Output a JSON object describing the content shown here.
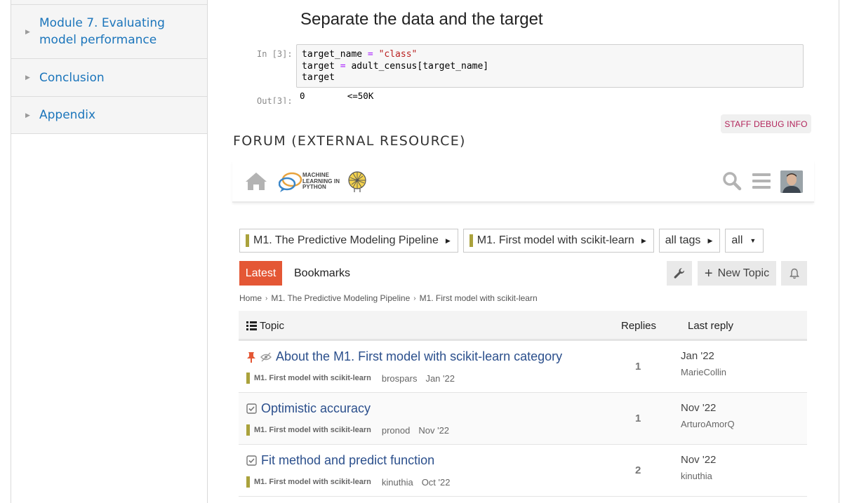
{
  "sidebar": {
    "items": [
      {
        "label": "Module 7. Evaluating model performance"
      },
      {
        "label": "Conclusion"
      },
      {
        "label": "Appendix"
      }
    ]
  },
  "notebook": {
    "heading": "Separate the data and the target",
    "in_prompt": "In [3]:",
    "out_prompt": "Out[3]:",
    "code": {
      "line1_var": "target_name",
      "line1_op": " = ",
      "line1_str": "\"class\"",
      "line2_var": "target",
      "line2_op": " = ",
      "line2_expr": "adult_census[target_name]",
      "line3": "target"
    },
    "output": "0        <=50K"
  },
  "staff_debug_label": "STAFF DEBUG INFO",
  "forum_heading": "FORUM (EXTERNAL RESOURCE)",
  "forum": {
    "logo_text": [
      "MACHINE",
      "LEARNING IN",
      "PYTHON"
    ],
    "filters": [
      {
        "label": "M1. The Predictive Modeling Pipeline",
        "has_swatch": true
      },
      {
        "label": "M1. First model with scikit-learn",
        "has_swatch": true
      },
      {
        "label": "all tags",
        "has_swatch": false
      },
      {
        "label": "all",
        "has_swatch": false
      }
    ],
    "nav": {
      "latest": "Latest",
      "bookmarks": "Bookmarks",
      "new_topic": "New Topic"
    },
    "breadcrumbs": [
      "Home",
      "M1. The Predictive Modeling Pipeline",
      "M1. First model with scikit-learn"
    ],
    "table": {
      "col_topic": "Topic",
      "col_replies": "Replies",
      "col_last_reply": "Last reply",
      "rows": [
        {
          "title": "About the M1. First model with scikit-learn category",
          "category": "M1. First model with scikit-learn",
          "author": "brospars",
          "created": "Jan '22",
          "replies": "1",
          "last_date": "Jan '22",
          "last_user": "MarieCollin",
          "status": "pinned"
        },
        {
          "title": "Optimistic accuracy",
          "category": "M1. First model with scikit-learn",
          "author": "pronod",
          "created": "Nov '22",
          "replies": "1",
          "last_date": "Nov '22",
          "last_user": "ArturoAmorQ",
          "status": "solved"
        },
        {
          "title": "Fit method and predict function",
          "category": "M1. First model with scikit-learn",
          "author": "kinuthia",
          "created": "Oct '22",
          "replies": "2",
          "last_date": "Nov '22",
          "last_user": "kinuthia",
          "status": "solved"
        }
      ]
    }
  },
  "colors": {
    "link_blue": "#1b75bb",
    "topic_blue": "#2b4f8c",
    "latest_orange": "#e45735",
    "category_swatch": "#aaa23c",
    "pin_red": "#e45735",
    "staff_text": "#b2245a"
  }
}
